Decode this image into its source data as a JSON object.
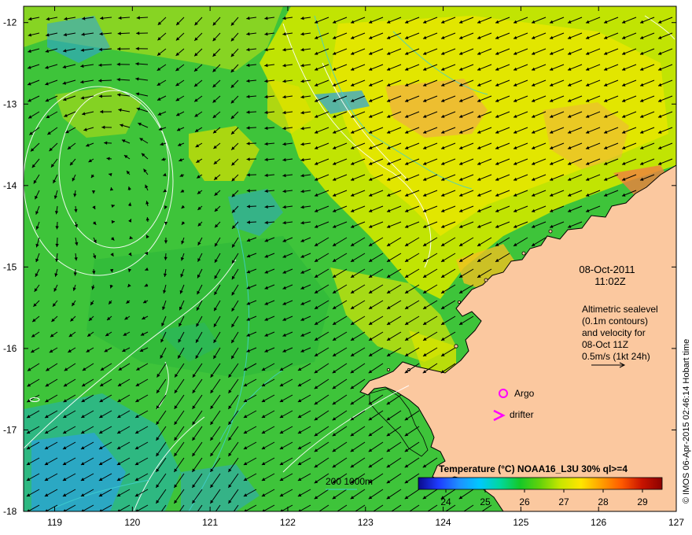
{
  "map": {
    "lon_ticks": [
      "119",
      "120",
      "121",
      "122",
      "123",
      "124",
      "125",
      "126",
      "127"
    ],
    "lat_ticks": [
      "-12",
      "-13",
      "-14",
      "-15",
      "-16",
      "-17",
      "-18"
    ],
    "lon_range": [
      118.6,
      127.0
    ],
    "lat_range": [
      -18.0,
      -11.8
    ]
  },
  "timestamp": {
    "date": "08-Oct-2011",
    "time": "11:02Z"
  },
  "legend_text": {
    "line1": "Altimetric sealevel",
    "line2": "(0.1m contours)",
    "line3": "and velocity for",
    "line4": "08-Oct 11Z",
    "line5": "0.5m/s (1kt 24h)"
  },
  "markers": {
    "argo_label": "Argo",
    "drifter_label": "drifter",
    "argo_color": "#ff00ff",
    "drifter_color": "#ff00ff"
  },
  "depth_legend": {
    "label": "200  1000m",
    "contour_color": "#40d0d0"
  },
  "colorbar": {
    "title": "Temperature (°C) NOAA16_L3U 30% ql>=4",
    "ticks": [
      "24",
      "25",
      "26",
      "27",
      "28",
      "29"
    ],
    "range": [
      23.3,
      29.5
    ],
    "colors": [
      "#0a0a8c",
      "#1e3cff",
      "#1e90ff",
      "#00c8ff",
      "#00d8a0",
      "#14c828",
      "#64d20a",
      "#c8e600",
      "#ffe600",
      "#ffa000",
      "#ff5a00",
      "#c81400",
      "#8c0000"
    ]
  },
  "credit": "© IMOS 06-Apr-2015 02:46:14 Hobart time",
  "colors": {
    "land": "#fbc89f",
    "coast": "#000000",
    "arrow": "#000000",
    "sealevel_contour": "#ffffff",
    "sea_green": "#3ec43a",
    "sea_yellow": "#e6e600",
    "sea_orange": "#f0a840",
    "sea_blue": "#2aa0e6"
  }
}
